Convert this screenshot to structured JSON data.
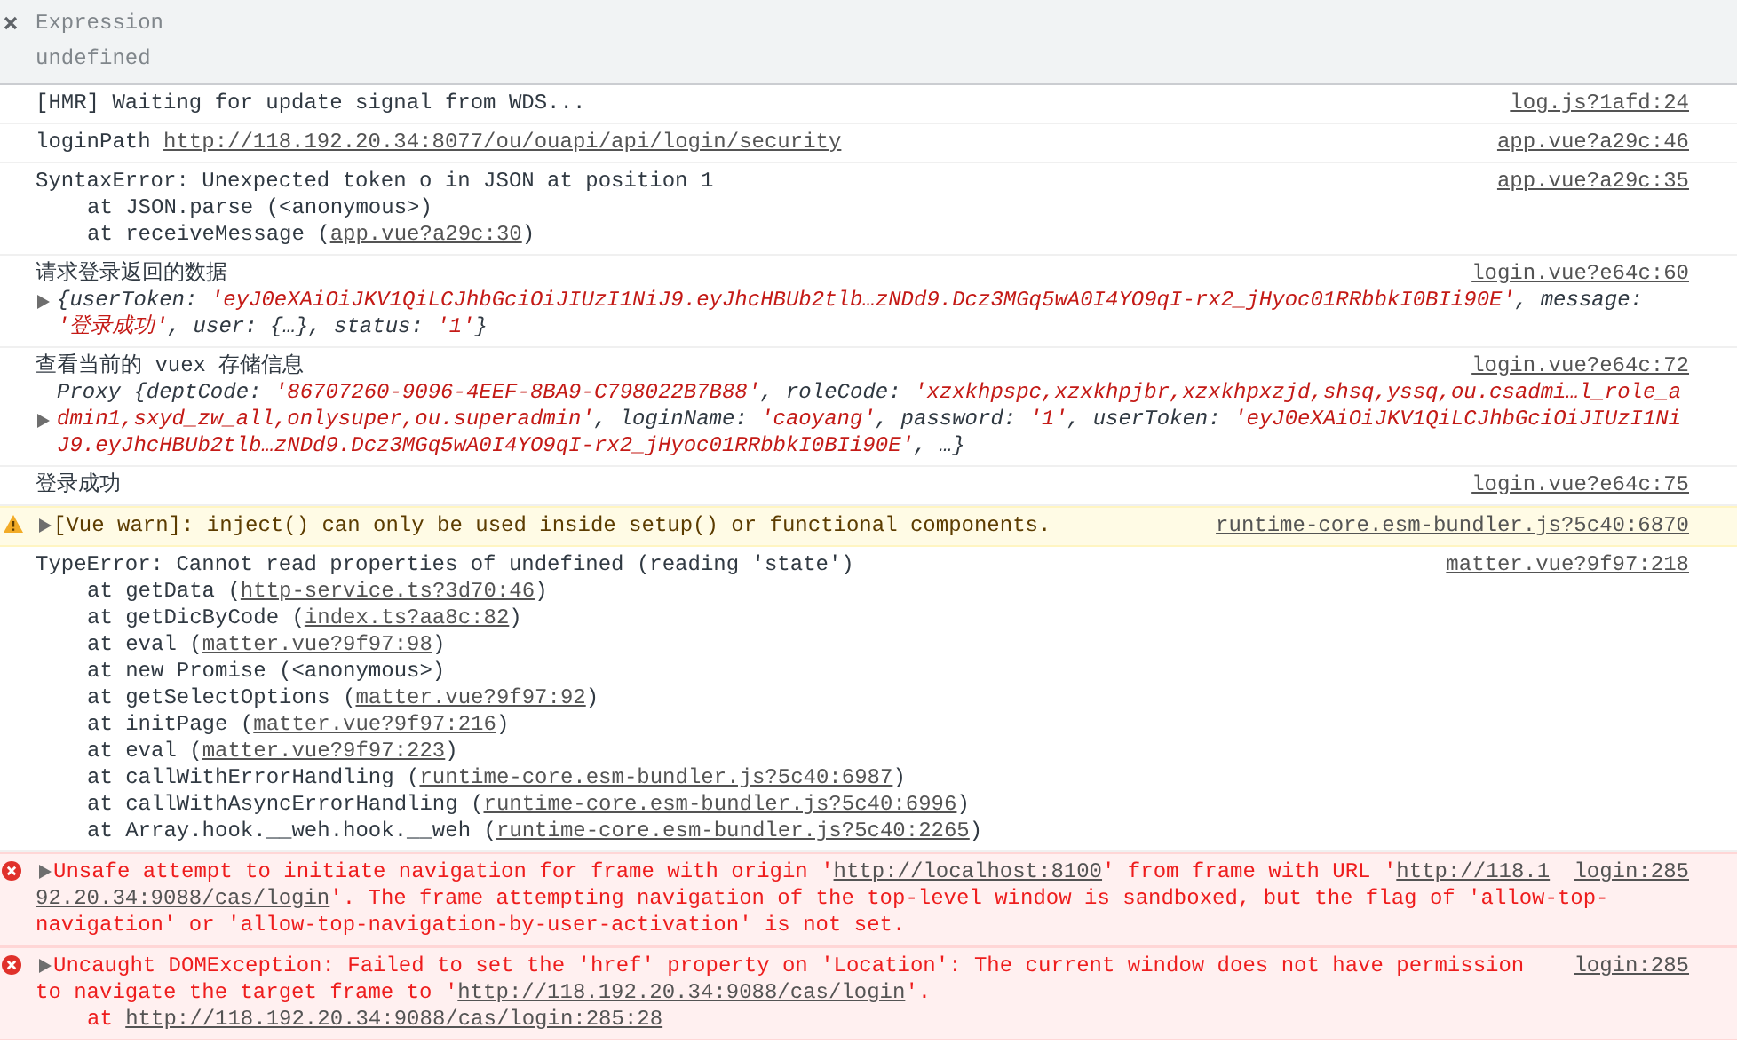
{
  "expression": {
    "label": "Expression",
    "value": "undefined"
  },
  "messages": [
    {
      "kind": "log",
      "source": "log.js?1afd:24",
      "lines": [
        {
          "kind": "text",
          "segs": [
            {
              "kind": "plain",
              "text": "[HMR] Waiting for update signal from WDS..."
            }
          ]
        }
      ]
    },
    {
      "kind": "log",
      "source": "app.vue?a29c:46",
      "lines": [
        {
          "kind": "text",
          "segs": [
            {
              "kind": "plain",
              "text": "loginPath "
            },
            {
              "kind": "link",
              "text": "http://118.192.20.34:8077/ou/ouapi/api/login/security"
            }
          ]
        }
      ]
    },
    {
      "kind": "log",
      "source": "app.vue?a29c:35",
      "lines": [
        {
          "kind": "text",
          "segs": [
            {
              "kind": "plain",
              "text": "SyntaxError: Unexpected token o in JSON at position 1"
            }
          ]
        },
        {
          "kind": "stack",
          "segs": [
            {
              "kind": "plain",
              "text": "at JSON.parse (<anonymous>)"
            }
          ]
        },
        {
          "kind": "stack",
          "segs": [
            {
              "kind": "plain",
              "text": "at receiveMessage ("
            },
            {
              "kind": "link",
              "text": "app.vue?a29c:30"
            },
            {
              "kind": "plain",
              "text": ")"
            }
          ]
        }
      ]
    },
    {
      "kind": "log",
      "source": "login.vue?e64c:60",
      "lines": [
        {
          "kind": "text",
          "segs": [
            {
              "kind": "plain",
              "text": "请求登录返回的数据"
            }
          ]
        },
        {
          "kind": "object",
          "expanded": false,
          "segs": [
            {
              "kind": "plain",
              "text": "{userToken: "
            },
            {
              "kind": "string",
              "text": "'eyJ0eXAiOiJKV1QiLCJhbGciOiJIUzI1NiJ9.eyJhcHBUb2tlb…zNDd9.Dcz3MGq5wA0I4YO9qI-rx2_jHyoc01RRbbkI0BIi90E'"
            },
            {
              "kind": "plain",
              "text": ", message:"
            }
          ]
        },
        {
          "kind": "object",
          "segs": [
            {
              "kind": "string",
              "text": "'登录成功'"
            },
            {
              "kind": "plain",
              "text": ", user: {…}, status: "
            },
            {
              "kind": "string",
              "text": "'1'"
            },
            {
              "kind": "plain",
              "text": "}"
            }
          ]
        }
      ]
    },
    {
      "kind": "log",
      "source": "login.vue?e64c:72",
      "lines": [
        {
          "kind": "text",
          "segs": [
            {
              "kind": "plain",
              "text": "查看当前的 vuex 存储信息"
            }
          ]
        },
        {
          "kind": "object",
          "segs": [
            {
              "kind": "plain",
              "text": "Proxy {deptCode: "
            },
            {
              "kind": "string",
              "text": "'86707260-9096-4EEF-8BA9-C798022B7B88'"
            },
            {
              "kind": "plain",
              "text": ", roleCode: "
            },
            {
              "kind": "string",
              "text": "'xzxkhpspc,xzxkhpjbr,xzxkhpxzjd,shsq,yssq,ou.csadmi…l_role_a"
            }
          ]
        },
        {
          "kind": "object",
          "expanded": false,
          "segs": [
            {
              "kind": "string",
              "text": "dmin1,sxyd_zw_all,onlysuper,ou.superadmin'"
            },
            {
              "kind": "plain",
              "text": ", loginName: "
            },
            {
              "kind": "string",
              "text": "'caoyang'"
            },
            {
              "kind": "plain",
              "text": ", password: "
            },
            {
              "kind": "string",
              "text": "'1'"
            },
            {
              "kind": "plain",
              "text": ", userToken: "
            },
            {
              "kind": "string",
              "text": "'eyJ0eXAiOiJKV1QiLCJhbGciOiJIUzI1Ni"
            }
          ]
        },
        {
          "kind": "object",
          "segs": [
            {
              "kind": "string",
              "text": "J9.eyJhcHBUb2tlb…zNDd9.Dcz3MGq5wA0I4YO9qI-rx2_jHyoc01RRbbkI0BIi90E'"
            },
            {
              "kind": "plain",
              "text": ", …}"
            }
          ]
        }
      ]
    },
    {
      "kind": "log",
      "source": "login.vue?e64c:75",
      "lines": [
        {
          "kind": "text",
          "segs": [
            {
              "kind": "plain",
              "text": "登录成功"
            }
          ]
        }
      ]
    },
    {
      "kind": "warning",
      "source": "runtime-core.esm-bundler.js?5c40:6870",
      "lines": [
        {
          "kind": "text",
          "expanded": false,
          "segs": [
            {
              "kind": "plain",
              "text": "[Vue warn]: inject() can only be used inside setup() or functional components."
            }
          ]
        }
      ]
    },
    {
      "kind": "log",
      "source": "matter.vue?9f97:218",
      "lines": [
        {
          "kind": "text",
          "segs": [
            {
              "kind": "plain",
              "text": "TypeError: Cannot read properties of undefined (reading 'state')"
            }
          ]
        },
        {
          "kind": "stack",
          "segs": [
            {
              "kind": "plain",
              "text": "at getData ("
            },
            {
              "kind": "link",
              "text": "http-service.ts?3d70:46"
            },
            {
              "kind": "plain",
              "text": ")"
            }
          ]
        },
        {
          "kind": "stack",
          "segs": [
            {
              "kind": "plain",
              "text": "at getDicByCode ("
            },
            {
              "kind": "link",
              "text": "index.ts?aa8c:82"
            },
            {
              "kind": "plain",
              "text": ")"
            }
          ]
        },
        {
          "kind": "stack",
          "segs": [
            {
              "kind": "plain",
              "text": "at eval ("
            },
            {
              "kind": "link",
              "text": "matter.vue?9f97:98"
            },
            {
              "kind": "plain",
              "text": ")"
            }
          ]
        },
        {
          "kind": "stack",
          "segs": [
            {
              "kind": "plain",
              "text": "at new Promise (<anonymous>)"
            }
          ]
        },
        {
          "kind": "stack",
          "segs": [
            {
              "kind": "plain",
              "text": "at getSelectOptions ("
            },
            {
              "kind": "link",
              "text": "matter.vue?9f97:92"
            },
            {
              "kind": "plain",
              "text": ")"
            }
          ]
        },
        {
          "kind": "stack",
          "segs": [
            {
              "kind": "plain",
              "text": "at initPage ("
            },
            {
              "kind": "link",
              "text": "matter.vue?9f97:216"
            },
            {
              "kind": "plain",
              "text": ")"
            }
          ]
        },
        {
          "kind": "stack",
          "segs": [
            {
              "kind": "plain",
              "text": "at eval ("
            },
            {
              "kind": "link",
              "text": "matter.vue?9f97:223"
            },
            {
              "kind": "plain",
              "text": ")"
            }
          ]
        },
        {
          "kind": "stack",
          "segs": [
            {
              "kind": "plain",
              "text": "at callWithErrorHandling ("
            },
            {
              "kind": "link",
              "text": "runtime-core.esm-bundler.js?5c40:6987"
            },
            {
              "kind": "plain",
              "text": ")"
            }
          ]
        },
        {
          "kind": "stack",
          "segs": [
            {
              "kind": "plain",
              "text": "at callWithAsyncErrorHandling ("
            },
            {
              "kind": "link",
              "text": "runtime-core.esm-bundler.js?5c40:6996"
            },
            {
              "kind": "plain",
              "text": ")"
            }
          ]
        },
        {
          "kind": "stack",
          "segs": [
            {
              "kind": "plain",
              "text": "at Array.hook.__weh.hook.__weh ("
            },
            {
              "kind": "link",
              "text": "runtime-core.esm-bundler.js?5c40:2265"
            },
            {
              "kind": "plain",
              "text": ")"
            }
          ]
        }
      ]
    },
    {
      "kind": "error",
      "source": "login:285",
      "lines": [
        {
          "kind": "text",
          "expanded": false,
          "segs": [
            {
              "kind": "plain",
              "text": "Unsafe attempt to initiate navigation for frame with origin '"
            },
            {
              "kind": "link",
              "text": "http://localhost:8100"
            },
            {
              "kind": "plain",
              "text": "' from frame with URL '"
            },
            {
              "kind": "link",
              "text": "http://118.1"
            }
          ]
        },
        {
          "kind": "text",
          "segs": [
            {
              "kind": "link",
              "text": "92.20.34:9088/cas/login"
            },
            {
              "kind": "plain",
              "text": "'. The frame attempting navigation of the top-level window is sandboxed, but the flag of 'allow-top-"
            }
          ]
        },
        {
          "kind": "text",
          "segs": [
            {
              "kind": "plain",
              "text": "navigation' or 'allow-top-navigation-by-user-activation' is not set."
            }
          ]
        }
      ]
    },
    {
      "kind": "error",
      "source": "login:285",
      "lines": [
        {
          "kind": "text",
          "expanded": false,
          "segs": [
            {
              "kind": "plain",
              "text": "Uncaught DOMException: Failed to set the 'href' property on 'Location': The current window does not have permission"
            }
          ]
        },
        {
          "kind": "text",
          "segs": [
            {
              "kind": "plain",
              "text": "to navigate the target frame to '"
            },
            {
              "kind": "link",
              "text": "http://118.192.20.34:9088/cas/login"
            },
            {
              "kind": "plain",
              "text": "'."
            }
          ]
        },
        {
          "kind": "stack",
          "segs": [
            {
              "kind": "plain",
              "text": "at "
            },
            {
              "kind": "link",
              "text": "http://118.192.20.34:9088/cas/login:285:28"
            }
          ]
        }
      ]
    }
  ]
}
